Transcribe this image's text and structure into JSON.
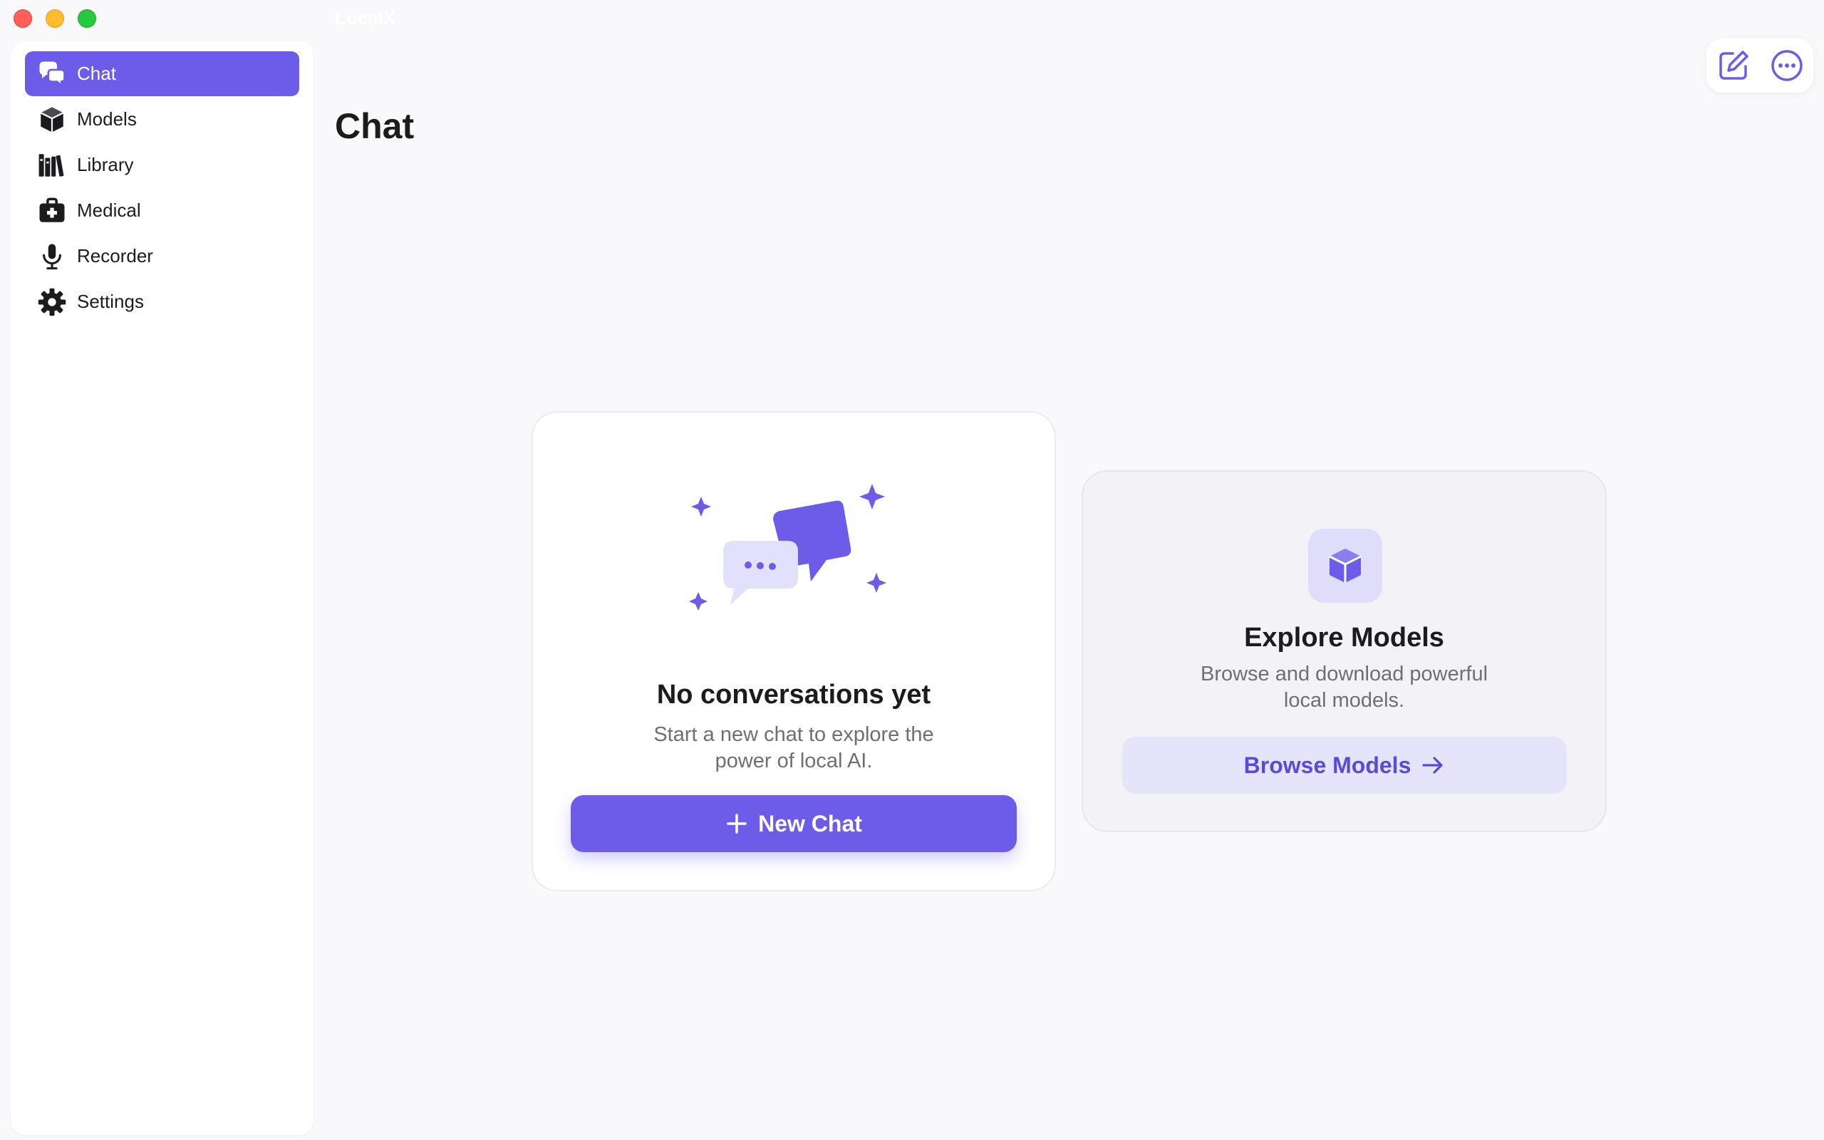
{
  "window": {
    "app_name": "LocalX"
  },
  "sidebar": {
    "items": [
      {
        "label": "Chat",
        "icon": "chat-bubbles-icon",
        "active": true
      },
      {
        "label": "Models",
        "icon": "cube-icon",
        "active": false
      },
      {
        "label": "Library",
        "icon": "books-icon",
        "active": false
      },
      {
        "label": "Medical",
        "icon": "medical-kit-icon",
        "active": false
      },
      {
        "label": "Recorder",
        "icon": "microphone-icon",
        "active": false
      },
      {
        "label": "Settings",
        "icon": "gear-icon",
        "active": false
      }
    ]
  },
  "header": {
    "title": "Chat"
  },
  "toolbar": {
    "compose_icon": "compose-icon",
    "more_icon": "more-icon"
  },
  "empty_state": {
    "title": "No conversations yet",
    "description": "Start a new chat to explore the power of local AI.",
    "button_label": "New Chat"
  },
  "explore": {
    "title": "Explore Models",
    "description": "Browse and download powerful local models.",
    "button_label": "Browse Models"
  },
  "colors": {
    "accent": "#6c5ce7",
    "accent_light": "#e6e4fa",
    "background": "#f9f9fc"
  }
}
